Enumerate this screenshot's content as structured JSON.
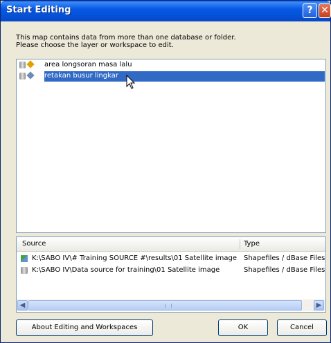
{
  "window": {
    "title": "Start Editing"
  },
  "description": {
    "line1": "This map contains data from more than one database or folder.",
    "line2": "Please choose the layer or workspace to edit."
  },
  "layers": [
    {
      "label": "area longsoran masa lalu",
      "icon_color": "#e1a200",
      "selected": false
    },
    {
      "label": "retakan busur lingkar",
      "icon_color": "#6e8ab7",
      "selected": true
    }
  ],
  "source_table": {
    "headers": {
      "source": "Source",
      "type": "Type"
    },
    "rows": [
      {
        "path": "K:\\SABO IV\\# Training SOURCE #\\results\\01 Satellite image",
        "type": "Shapefiles / dBase Files"
      },
      {
        "path": "K:\\SABO IV\\Data source for training\\01 Satellite image",
        "type": "Shapefiles / dBase Files"
      }
    ]
  },
  "buttons": {
    "about": "About Editing and Workspaces",
    "ok": "OK",
    "cancel": "Cancel"
  },
  "colors": {
    "title_bar": "#0758e5",
    "selection": "#316ac5"
  }
}
